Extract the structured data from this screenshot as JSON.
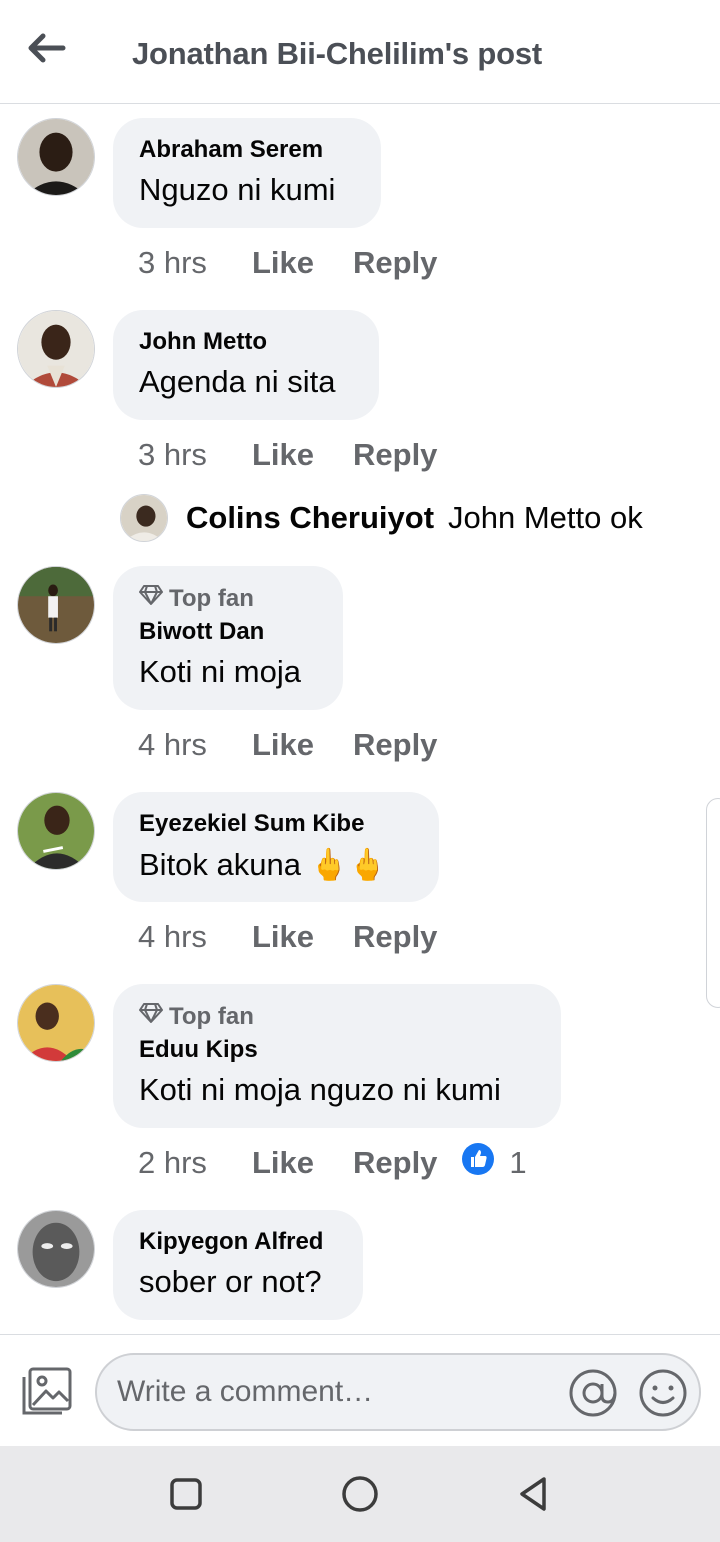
{
  "header": {
    "title": "Jonathan Bii-Chelilim's post",
    "back_icon": "arrow-left-icon"
  },
  "comments": [
    {
      "author": "Abraham Serem",
      "text": "Nguzo ni kumi",
      "time": "3 hrs",
      "like_label": "Like",
      "reply_label": "Reply"
    },
    {
      "author": "John Metto",
      "text": "Agenda ni sita",
      "time": "3 hrs",
      "like_label": "Like",
      "reply_label": "Reply",
      "reply_preview": {
        "author": "Colins Cheruiyot",
        "text": "John Metto ok"
      }
    },
    {
      "badge": "Top fan",
      "author": "Biwott Dan",
      "text": "Koti ni moja",
      "time": "4 hrs",
      "like_label": "Like",
      "reply_label": "Reply"
    },
    {
      "author": "Eyezekiel Sum Kibe",
      "text": "Bitok akuna 🖕🖕",
      "time": "4 hrs",
      "like_label": "Like",
      "reply_label": "Reply"
    },
    {
      "badge": "Top fan",
      "author": "Eduu Kips",
      "text": "Koti ni moja nguzo ni kumi",
      "time": "2 hrs",
      "like_label": "Like",
      "reply_label": "Reply",
      "reactions": "1",
      "reaction_icon": "thumbs-up-icon"
    },
    {
      "author": "Kipyegon Alfred",
      "text": "sober or not?"
    }
  ],
  "composer": {
    "placeholder": "Write a comment…",
    "photo_icon": "photo-icon",
    "mention_icon": "at-icon",
    "emoji_icon": "smiley-icon"
  },
  "colors": {
    "bubble": "#f0f2f5",
    "meta_text": "#65676b",
    "like_blue": "#1877f2"
  }
}
